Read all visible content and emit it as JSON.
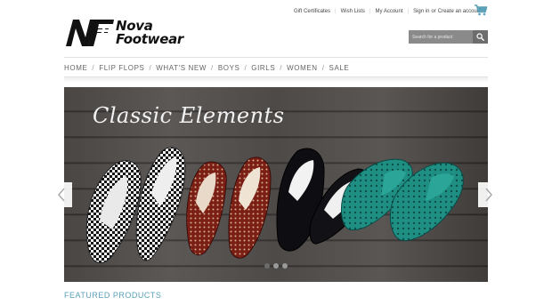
{
  "header": {
    "links": [
      {
        "label": "Gift Certificates"
      },
      {
        "label": "Wish Lists"
      },
      {
        "label": "My Account"
      }
    ],
    "sign_in_label": "Sign in",
    "or_label": "or",
    "create_account_label": "Create an account",
    "cart_icon": "shopping-cart-icon"
  },
  "logo": {
    "mark": "NF",
    "line1": "Nova",
    "line2": "Footwear"
  },
  "search": {
    "placeholder": "Search for a product",
    "button_icon": "search-icon"
  },
  "nav": {
    "items": [
      {
        "label": "HOME"
      },
      {
        "label": "FLIP FLOPS"
      },
      {
        "label": "WHAT'S NEW"
      },
      {
        "label": "BOYS"
      },
      {
        "label": "GIRLS"
      },
      {
        "label": "WOMEN"
      },
      {
        "label": "SALE"
      }
    ]
  },
  "slider": {
    "title": "Classic Elements",
    "prev_icon": "chevron-left-icon",
    "next_icon": "chevron-right-icon",
    "slide_count": 3,
    "active_slide": 1
  },
  "featured": {
    "heading": "FEATURED PRODUCTS"
  },
  "colors": {
    "accent": "#5aa0b8",
    "nav_text": "#666666",
    "search_bg": "#8a8a8a"
  }
}
